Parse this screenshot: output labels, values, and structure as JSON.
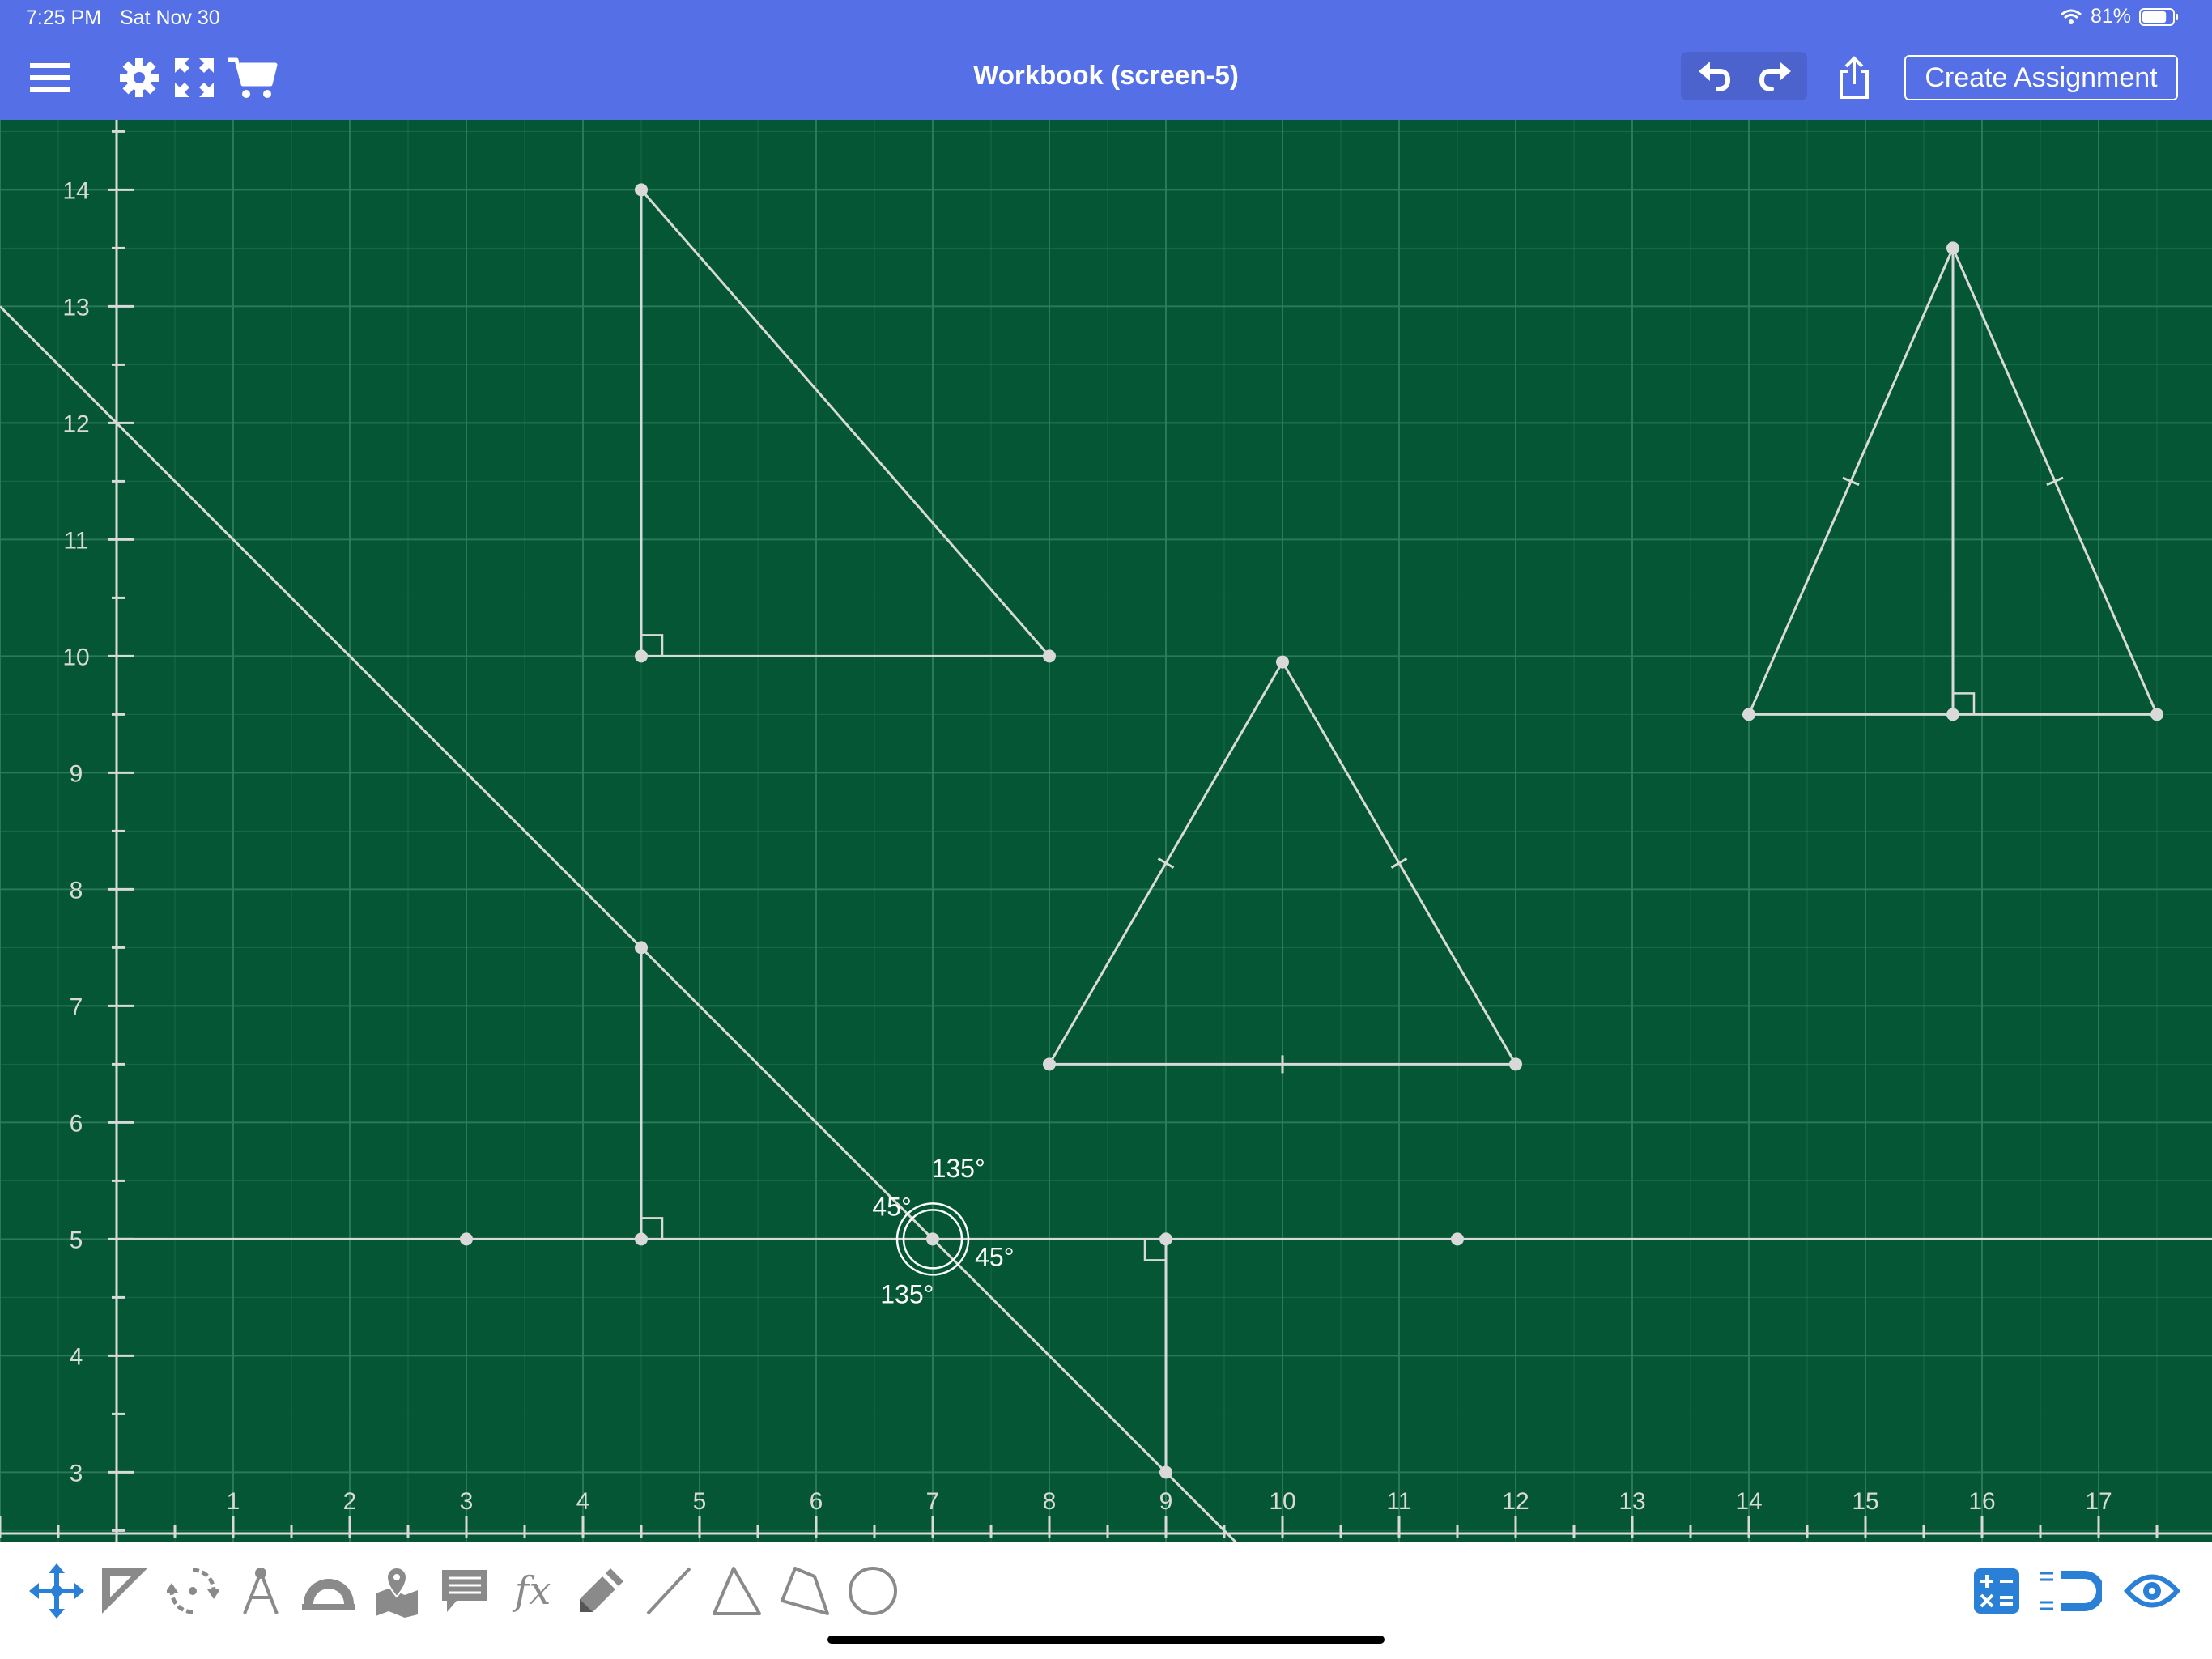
{
  "status_bar": {
    "time": "7:25 PM",
    "date": "Sat Nov 30",
    "battery": "81%",
    "battery_level": 0.81
  },
  "nav": {
    "title": "Workbook (screen-5)",
    "create_assignment": "Create Assignment",
    "icons": {
      "menu": "hamburger-menu-icon",
      "settings": "gear-icon",
      "fullscreen": "expand-icon",
      "store": "shopping-cart-icon",
      "undo": "undo-icon",
      "redo": "redo-icon",
      "share": "share-icon"
    }
  },
  "colors": {
    "nav_background": "#5570e6",
    "canvas_background": "#045634",
    "grid_line": "#2f7d5c",
    "figure_stroke": "#d9d9d9",
    "tool_gray": "#8a8a8a",
    "tool_accent": "#2a7fd6"
  },
  "canvas": {
    "x_axis_ticks": [
      "1",
      "2",
      "3",
      "4",
      "5",
      "6",
      "7",
      "8",
      "9",
      "10",
      "11",
      "12",
      "13",
      "14",
      "15",
      "16",
      "17"
    ],
    "y_axis_ticks": [
      "3",
      "4",
      "5",
      "6",
      "7",
      "8",
      "9",
      "10",
      "11",
      "12",
      "13",
      "14"
    ],
    "x_range": [
      -1,
      18
    ],
    "y_range": [
      2.4,
      14.6
    ],
    "angle_labels": [
      {
        "text": "135°",
        "x": 7.22,
        "y": 5.53
      },
      {
        "text": "45°",
        "x": 6.65,
        "y": 5.2
      },
      {
        "text": "45°",
        "x": 7.53,
        "y": 4.77
      },
      {
        "text": "135°",
        "x": 6.78,
        "y": 4.45
      }
    ],
    "intersection": {
      "x": 7,
      "y": 5
    },
    "lines": [
      {
        "name": "horizontal-line-y5",
        "p1": [
          0,
          5
        ],
        "p2": [
          18,
          5
        ]
      },
      {
        "name": "diagonal-line",
        "p1": [
          -1,
          13
        ],
        "p2": [
          10,
          2
        ]
      }
    ],
    "segments": [
      {
        "name": "perpendicular-segment-x45",
        "p1": [
          4.5,
          5
        ],
        "p2": [
          4.5,
          7.5
        ]
      },
      {
        "name": "perpendicular-segment-x9",
        "p1": [
          9,
          5
        ],
        "p2": [
          9,
          3
        ]
      }
    ],
    "points": [
      {
        "name": "point-3-5",
        "x": 3,
        "y": 5
      },
      {
        "name": "point-4.5-5",
        "x": 4.5,
        "y": 5
      },
      {
        "name": "point-4.5-7.5",
        "x": 4.5,
        "y": 7.5
      },
      {
        "name": "point-7-5",
        "x": 7,
        "y": 5
      },
      {
        "name": "point-9-5",
        "x": 9,
        "y": 5
      },
      {
        "name": "point-9-3",
        "x": 9,
        "y": 3
      },
      {
        "name": "point-11.5-5",
        "x": 11.5,
        "y": 5
      }
    ],
    "triangles": [
      {
        "name": "right-triangle",
        "vertices": [
          [
            4.5,
            14
          ],
          [
            4.5,
            10
          ],
          [
            8,
            10
          ]
        ]
      },
      {
        "name": "equilateral-triangle",
        "vertices": [
          [
            8,
            6.5
          ],
          [
            10,
            9.95
          ],
          [
            12,
            6.5
          ]
        ],
        "tick_marks": true
      },
      {
        "name": "isosceles-triangle",
        "vertices": [
          [
            14,
            9.5
          ],
          [
            15.75,
            13.5
          ],
          [
            17.5,
            9.5
          ]
        ],
        "tick_marks": true,
        "altitude": [
          [
            15.75,
            13.5
          ],
          [
            15.75,
            9.5
          ]
        ]
      }
    ],
    "right_angles": [
      {
        "name": "right-angle-triangle-corner",
        "x": 4.5,
        "y": 10,
        "dx": 1,
        "dy": 1
      },
      {
        "name": "right-angle-x45",
        "x": 4.5,
        "y": 5,
        "dx": 1,
        "dy": 1
      },
      {
        "name": "right-angle-x9",
        "x": 9,
        "y": 5,
        "dx": -1,
        "dy": -1
      },
      {
        "name": "right-angle-altitude",
        "x": 15.75,
        "y": 9.5,
        "dx": 1,
        "dy": 1
      }
    ]
  },
  "toolbar": {
    "left_tools": [
      "move-tool-icon",
      "set-square-icon",
      "rotate-icon",
      "compass-icon",
      "protractor-icon",
      "map-pin-icon",
      "comment-icon",
      "function-icon",
      "pencil-icon",
      "line-icon",
      "triangle-icon",
      "quadrilateral-icon",
      "circle-icon"
    ],
    "right_tools": [
      "calculator-icon",
      "magnet-snap-icon",
      "eye-visibility-icon"
    ],
    "function_label": "fx"
  }
}
